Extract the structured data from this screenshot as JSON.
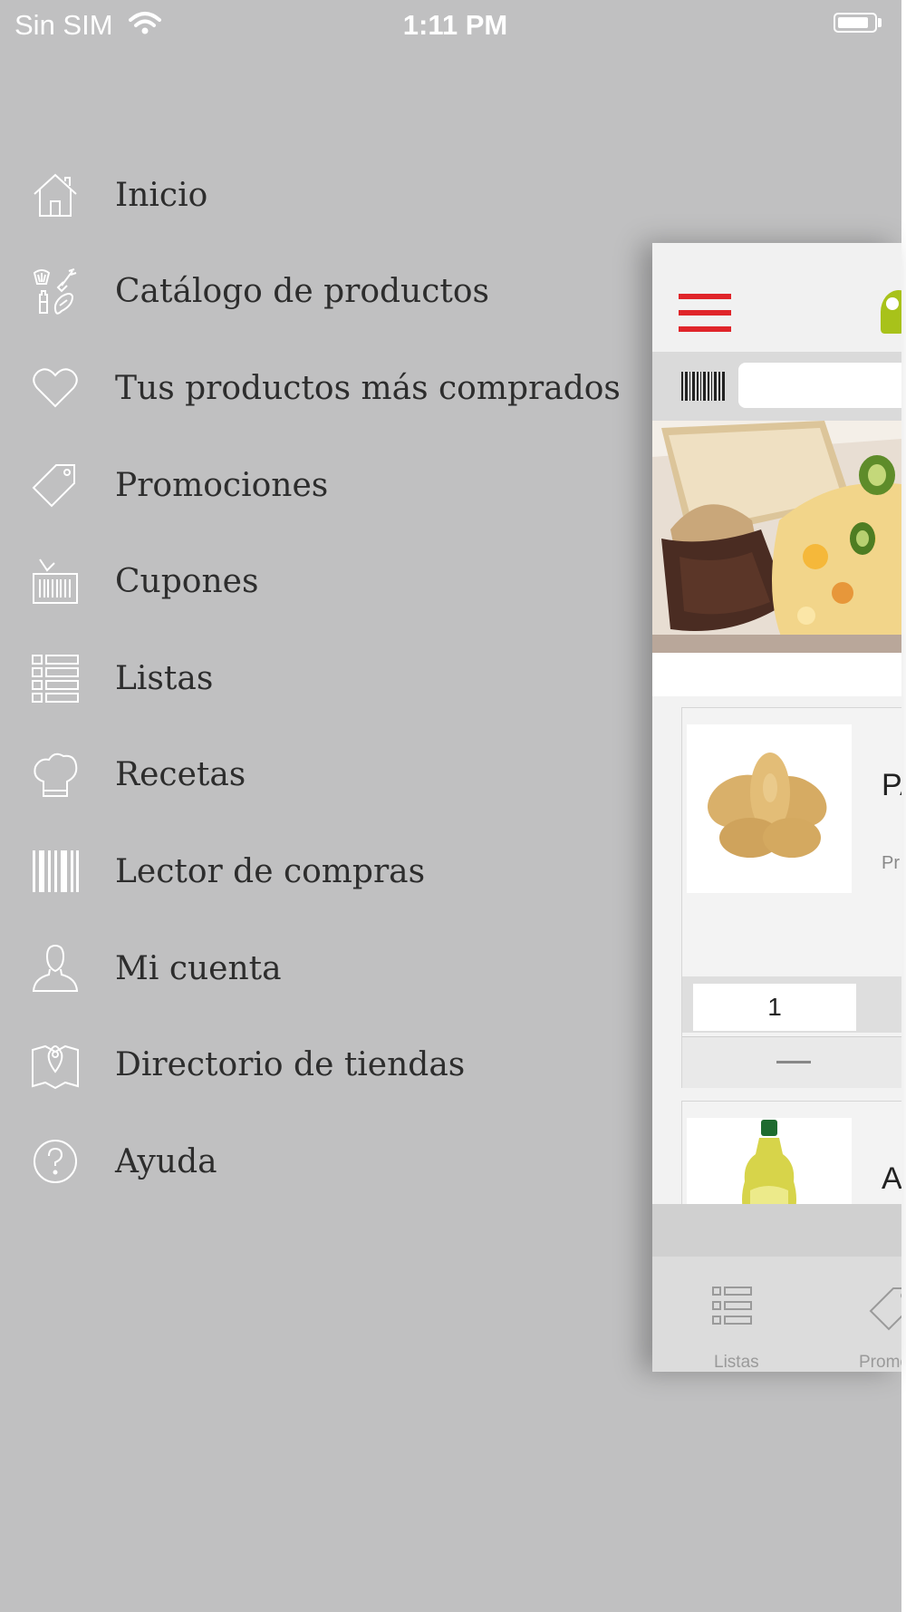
{
  "status_bar": {
    "carrier": "Sin SIM",
    "time": "1:11 PM",
    "battery_level": 0.75
  },
  "side_menu": {
    "items": [
      {
        "label": "Inicio",
        "icon": "home-icon"
      },
      {
        "label": "Catálogo de productos",
        "icon": "catalog-icon"
      },
      {
        "label": "Tus productos más comprados",
        "icon": "heart-icon"
      },
      {
        "label": "Promociones",
        "icon": "tag-icon"
      },
      {
        "label": "Cupones",
        "icon": "coupon-icon"
      },
      {
        "label": "Listas",
        "icon": "list-icon"
      },
      {
        "label": "Recetas",
        "icon": "chef-hat-icon"
      },
      {
        "label": "Lector de compras",
        "icon": "barcode-icon"
      },
      {
        "label": "Mi cuenta",
        "icon": "user-icon"
      },
      {
        "label": "Directorio de tiendas",
        "icon": "map-pin-icon"
      },
      {
        "label": "Ayuda",
        "icon": "help-icon"
      }
    ]
  },
  "app_preview": {
    "products": [
      {
        "name": "PA",
        "subtitle": "Pr",
        "quantity": "1"
      },
      {
        "name": "AC"
      }
    ],
    "tabs": [
      {
        "label": "Listas",
        "icon": "list-icon"
      },
      {
        "label": "Promo",
        "icon": "tag-icon"
      }
    ],
    "colors": {
      "menu_accent": "#e0252a",
      "logo": "#a8c21a",
      "overlay_bg": "#c0c0c1"
    }
  }
}
